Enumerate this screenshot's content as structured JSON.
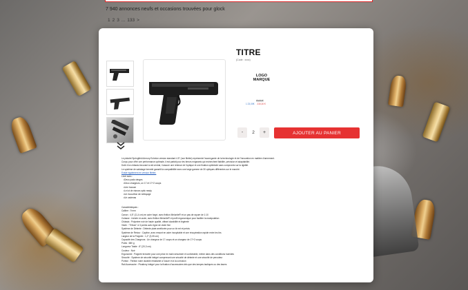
{
  "listing": {
    "result_count": "7 940 annonces neufs et occasions trouvées pour glock",
    "pager": [
      "1",
      "2",
      "3",
      "...",
      "133",
      ">"
    ]
  },
  "product": {
    "title": "TITRE",
    "code": "(Code : xxxx)",
    "logo_line1": "LOGO",
    "logo_line2": "MARQUE",
    "price_old": "00,00 €",
    "price_a": "1 23,00€",
    "price_b": "230,00 €",
    "quantity": "2",
    "qty_minus": "-",
    "qty_plus": "+",
    "add_to_cart": "AJOUTER AU PANIER"
  },
  "description": {
    "intro": [
      "Le pistolet Springfield Armory Echelon version standard 4.5\" (non filetée) représente l'avant-garde de la technologie et de l'innovation en matière d'armement.",
      "Conçu pour offrir une performance optimale, il est parfait pour les tireurs exigeants qui recherchent fiabilité, précision et adaptabilité.",
      "Doté d'un châssis innovant à rail central, il assure une retenue de l'optique et une fixation optimisée sans compromis sur la rigidité.",
      "Le système de sabotage breveté garantit la compatibilité avec une large gamme de 30 optiques différentes sur le marché."
    ],
    "link": "Existe également en version filetée.",
    "box_heading": "Livré avec :",
    "box_items": [
      "Deux pads vierges",
      "Deux chargeurs, un 17 et 17+2 coups",
      "Une housse",
      "Le lot de viseurs optic ready",
      "Un écouvillon de nettoyage",
      "Un cadenas"
    ],
    "spec_heading": "Caractéristiques :",
    "specs": [
      "Calibre : 9 mm",
      "Canon : 4,5\" (11,4 cm) en acier forgé, avec finition Melonite® et un pas de rayure de 1:10",
      "Culasse : Usinée en acier, avec finition Melonite® et profil ergonomique pour faciliter la manipulation",
      "Châssis : Polymère noir de haute qualité, offrant durabilité et légèreté",
      "Visée : \"Tritium\" à 3 points avec ligne de visée fixe",
      "Système de Détente : Détente plate améliorée pour un tir net et précis",
      "Système de Retour : Captive, avec ressort en acier inoxydable et une récupération rapide entre les tirs",
      "Largeur de la Poignée : 1,2\" (3,05 cm)",
      "Capacité des Chargeurs : Un chargeur de 17 coups et un chargeur de 17+2 coups",
      "Poids : 680 g",
      "Longueur Totale : 8\" (20,3 cm)",
      "Couleur : Noir",
      "Ergonomie : Poignée texturée pour une prise en main sécurisée et confortable, même dans des conditions humides",
      "Sécurité : Système de sécurité intégré comprenant une sécurité de détente et une sécurité de percuteur",
      "Portion : Finition noire durable résistante à l'usure et à la corrosion",
      "Rail Accessoire : Picatinny intégré pour la fixation d'accessoires tels que des lampes tactiques ou des lasers"
    ]
  },
  "colors": {
    "accent": "#e63232",
    "link": "#1a55b8",
    "price_blue": "#3a78c8",
    "price_red": "#d44444"
  },
  "icons": {
    "scroll_down": "double-chevron-down-icon"
  }
}
